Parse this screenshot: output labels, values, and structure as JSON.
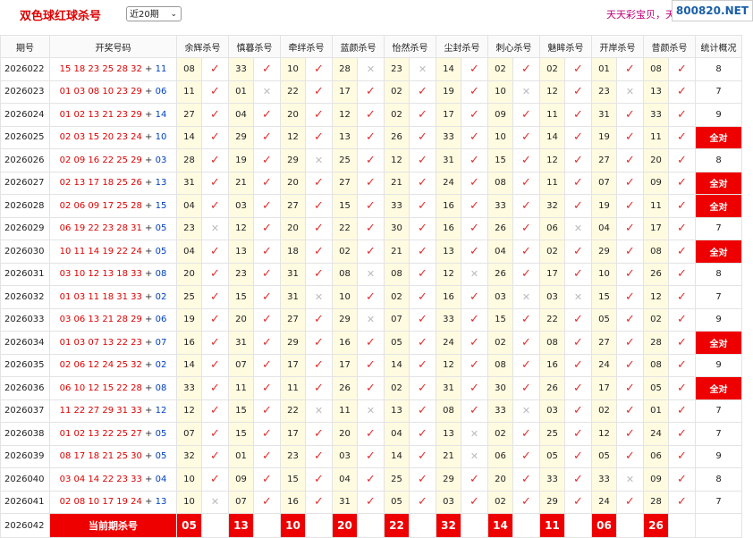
{
  "header": {
    "title": "双色球红球杀号",
    "period_select": "近20期",
    "marquee": "天天彩宝贝，天",
    "watermark": "800820.NET"
  },
  "table": {
    "headers": [
      "期号",
      "开奖号码",
      "余辉杀号",
      "慎暮杀号",
      "牵绊杀号",
      "蓝颜杀号",
      "怡然杀号",
      "尘封杀号",
      "刺心杀号",
      "魅眸杀号",
      "开岸杀号",
      "昔颜杀号",
      "统计概况"
    ],
    "rows": [
      {
        "issue": "2026022",
        "red": "15 18 23 25 28 32",
        "blue": "11",
        "kills": [
          [
            "08",
            1
          ],
          [
            "33",
            1
          ],
          [
            "10",
            1
          ],
          [
            "28",
            0
          ],
          [
            "23",
            0
          ],
          [
            "14",
            1
          ],
          [
            "02",
            1
          ],
          [
            "02",
            1
          ],
          [
            "01",
            1
          ],
          [
            "08",
            1
          ]
        ],
        "stat": "8"
      },
      {
        "issue": "2026023",
        "red": "01 03 08 10 23 29",
        "blue": "06",
        "kills": [
          [
            "11",
            1
          ],
          [
            "01",
            0
          ],
          [
            "22",
            1
          ],
          [
            "17",
            1
          ],
          [
            "02",
            1
          ],
          [
            "19",
            1
          ],
          [
            "10",
            0
          ],
          [
            "12",
            1
          ],
          [
            "23",
            0
          ],
          [
            "13",
            1
          ]
        ],
        "stat": "7"
      },
      {
        "issue": "2026024",
        "red": "01 02 13 21 23 29",
        "blue": "14",
        "kills": [
          [
            "27",
            1
          ],
          [
            "04",
            1
          ],
          [
            "20",
            1
          ],
          [
            "12",
            1
          ],
          [
            "02",
            1
          ],
          [
            "17",
            1
          ],
          [
            "09",
            1
          ],
          [
            "11",
            1
          ],
          [
            "31",
            1
          ],
          [
            "33",
            1
          ]
        ],
        "stat": "9"
      },
      {
        "issue": "2026025",
        "red": "02 03 15 20 23 24",
        "blue": "10",
        "kills": [
          [
            "14",
            1
          ],
          [
            "29",
            1
          ],
          [
            "12",
            1
          ],
          [
            "13",
            1
          ],
          [
            "26",
            1
          ],
          [
            "33",
            1
          ],
          [
            "10",
            1
          ],
          [
            "14",
            1
          ],
          [
            "19",
            1
          ],
          [
            "11",
            1
          ]
        ],
        "stat": "全对"
      },
      {
        "issue": "2026026",
        "red": "02 09 16 22 25 29",
        "blue": "03",
        "kills": [
          [
            "28",
            1
          ],
          [
            "19",
            1
          ],
          [
            "29",
            0
          ],
          [
            "25",
            1
          ],
          [
            "12",
            1
          ],
          [
            "31",
            1
          ],
          [
            "15",
            1
          ],
          [
            "12",
            1
          ],
          [
            "27",
            1
          ],
          [
            "20",
            1
          ]
        ],
        "stat": "8"
      },
      {
        "issue": "2026027",
        "red": "02 13 17 18 25 26",
        "blue": "13",
        "kills": [
          [
            "31",
            1
          ],
          [
            "21",
            1
          ],
          [
            "20",
            1
          ],
          [
            "27",
            1
          ],
          [
            "21",
            1
          ],
          [
            "24",
            1
          ],
          [
            "08",
            1
          ],
          [
            "11",
            1
          ],
          [
            "07",
            1
          ],
          [
            "09",
            1
          ]
        ],
        "stat": "全对"
      },
      {
        "issue": "2026028",
        "red": "02 06 09 17 25 28",
        "blue": "15",
        "kills": [
          [
            "04",
            1
          ],
          [
            "03",
            1
          ],
          [
            "27",
            1
          ],
          [
            "15",
            1
          ],
          [
            "33",
            1
          ],
          [
            "16",
            1
          ],
          [
            "33",
            1
          ],
          [
            "32",
            1
          ],
          [
            "19",
            1
          ],
          [
            "11",
            1
          ]
        ],
        "stat": "全对"
      },
      {
        "issue": "2026029",
        "red": "06 19 22 23 28 31",
        "blue": "05",
        "kills": [
          [
            "23",
            0
          ],
          [
            "12",
            1
          ],
          [
            "20",
            1
          ],
          [
            "22",
            1
          ],
          [
            "30",
            1
          ],
          [
            "16",
            1
          ],
          [
            "26",
            1
          ],
          [
            "06",
            0
          ],
          [
            "04",
            1
          ],
          [
            "17",
            1
          ]
        ],
        "stat": "7"
      },
      {
        "issue": "2026030",
        "red": "10 11 14 19 22 24",
        "blue": "05",
        "kills": [
          [
            "04",
            1
          ],
          [
            "13",
            1
          ],
          [
            "18",
            1
          ],
          [
            "02",
            1
          ],
          [
            "21",
            1
          ],
          [
            "13",
            1
          ],
          [
            "04",
            1
          ],
          [
            "02",
            1
          ],
          [
            "29",
            1
          ],
          [
            "08",
            1
          ]
        ],
        "stat": "全对"
      },
      {
        "issue": "2026031",
        "red": "03 10 12 13 18 33",
        "blue": "08",
        "kills": [
          [
            "20",
            1
          ],
          [
            "23",
            1
          ],
          [
            "31",
            1
          ],
          [
            "08",
            0
          ],
          [
            "08",
            1
          ],
          [
            "12",
            0
          ],
          [
            "26",
            1
          ],
          [
            "17",
            1
          ],
          [
            "10",
            1
          ],
          [
            "26",
            1
          ]
        ],
        "stat": "8"
      },
      {
        "issue": "2026032",
        "red": "01 03 11 18 31 33",
        "blue": "02",
        "kills": [
          [
            "25",
            1
          ],
          [
            "15",
            1
          ],
          [
            "31",
            0
          ],
          [
            "10",
            1
          ],
          [
            "02",
            1
          ],
          [
            "16",
            1
          ],
          [
            "03",
            0
          ],
          [
            "03",
            0
          ],
          [
            "15",
            1
          ],
          [
            "12",
            1
          ]
        ],
        "stat": "7"
      },
      {
        "issue": "2026033",
        "red": "03 06 13 21 28 29",
        "blue": "06",
        "kills": [
          [
            "19",
            1
          ],
          [
            "20",
            1
          ],
          [
            "27",
            1
          ],
          [
            "29",
            0
          ],
          [
            "07",
            1
          ],
          [
            "33",
            1
          ],
          [
            "15",
            1
          ],
          [
            "22",
            1
          ],
          [
            "05",
            1
          ],
          [
            "02",
            1
          ]
        ],
        "stat": "9"
      },
      {
        "issue": "2026034",
        "red": "01 03 07 13 22 23",
        "blue": "07",
        "kills": [
          [
            "16",
            1
          ],
          [
            "31",
            1
          ],
          [
            "29",
            1
          ],
          [
            "16",
            1
          ],
          [
            "05",
            1
          ],
          [
            "24",
            1
          ],
          [
            "02",
            1
          ],
          [
            "08",
            1
          ],
          [
            "27",
            1
          ],
          [
            "28",
            1
          ]
        ],
        "stat": "全对"
      },
      {
        "issue": "2026035",
        "red": "02 06 12 24 25 32",
        "blue": "02",
        "kills": [
          [
            "14",
            1
          ],
          [
            "07",
            1
          ],
          [
            "17",
            1
          ],
          [
            "17",
            1
          ],
          [
            "14",
            1
          ],
          [
            "12",
            1
          ],
          [
            "08",
            1
          ],
          [
            "16",
            1
          ],
          [
            "24",
            1
          ],
          [
            "08",
            1
          ]
        ],
        "stat": "9"
      },
      {
        "issue": "2026036",
        "red": "06 10 12 15 22 28",
        "blue": "08",
        "kills": [
          [
            "33",
            1
          ],
          [
            "11",
            1
          ],
          [
            "11",
            1
          ],
          [
            "26",
            1
          ],
          [
            "02",
            1
          ],
          [
            "31",
            1
          ],
          [
            "30",
            1
          ],
          [
            "26",
            1
          ],
          [
            "17",
            1
          ],
          [
            "05",
            1
          ]
        ],
        "stat": "全对"
      },
      {
        "issue": "2026037",
        "red": "11 22 27 29 31 33",
        "blue": "12",
        "kills": [
          [
            "12",
            1
          ],
          [
            "15",
            1
          ],
          [
            "22",
            0
          ],
          [
            "11",
            0
          ],
          [
            "13",
            1
          ],
          [
            "08",
            1
          ],
          [
            "33",
            0
          ],
          [
            "03",
            1
          ],
          [
            "02",
            1
          ],
          [
            "01",
            1
          ]
        ],
        "stat": "7"
      },
      {
        "issue": "2026038",
        "red": "01 02 13 22 25 27",
        "blue": "05",
        "kills": [
          [
            "07",
            1
          ],
          [
            "15",
            1
          ],
          [
            "17",
            1
          ],
          [
            "20",
            1
          ],
          [
            "04",
            1
          ],
          [
            "13",
            0
          ],
          [
            "02",
            1
          ],
          [
            "25",
            1
          ],
          [
            "12",
            1
          ],
          [
            "24",
            1
          ]
        ],
        "stat": "7"
      },
      {
        "issue": "2026039",
        "red": "08 17 18 21 25 30",
        "blue": "05",
        "kills": [
          [
            "32",
            1
          ],
          [
            "01",
            1
          ],
          [
            "23",
            1
          ],
          [
            "03",
            1
          ],
          [
            "14",
            1
          ],
          [
            "21",
            0
          ],
          [
            "06",
            1
          ],
          [
            "05",
            1
          ],
          [
            "05",
            1
          ],
          [
            "06",
            1
          ]
        ],
        "stat": "9"
      },
      {
        "issue": "2026040",
        "red": "03 04 14 22 23 33",
        "blue": "04",
        "kills": [
          [
            "10",
            1
          ],
          [
            "09",
            1
          ],
          [
            "15",
            1
          ],
          [
            "04",
            1
          ],
          [
            "25",
            1
          ],
          [
            "29",
            1
          ],
          [
            "20",
            1
          ],
          [
            "33",
            1
          ],
          [
            "33",
            0
          ],
          [
            "09",
            1
          ]
        ],
        "stat": "8"
      },
      {
        "issue": "2026041",
        "red": "02 08 10 17 19 24",
        "blue": "13",
        "kills": [
          [
            "10",
            0
          ],
          [
            "07",
            1
          ],
          [
            "16",
            1
          ],
          [
            "31",
            1
          ],
          [
            "05",
            1
          ],
          [
            "03",
            1
          ],
          [
            "02",
            1
          ],
          [
            "29",
            1
          ],
          [
            "24",
            1
          ],
          [
            "28",
            1
          ]
        ],
        "stat": "7"
      }
    ],
    "current": {
      "issue": "2026042",
      "label": "当前期杀号",
      "kills": [
        "05",
        "13",
        "10",
        "20",
        "22",
        "32",
        "14",
        "11",
        "06",
        "26"
      ]
    },
    "marks": {
      "ok": "✓",
      "no": "✕"
    },
    "colors": {
      "accent": "#e00000",
      "blue_ball": "#0040c0",
      "highlight": "#fffbe0"
    }
  }
}
